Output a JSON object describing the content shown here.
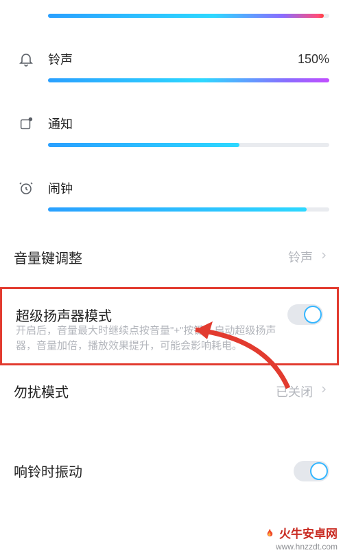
{
  "sliders": {
    "media": {
      "label": "",
      "value_text": "",
      "percent": 98
    },
    "ringtone": {
      "label": "铃声",
      "value_text": "150%",
      "percent": 100
    },
    "notification": {
      "label": "通知",
      "value_text": "",
      "percent": 68
    },
    "alarm": {
      "label": "闹钟",
      "value_text": "",
      "percent": 92
    }
  },
  "rows": {
    "volume_key": {
      "title": "音量键调整",
      "value": "铃声"
    },
    "super_speaker": {
      "title": "超级扬声器模式",
      "desc": "开启后，音量最大时继续点按音量\"+\"按键，启动超级扬声器，音量加倍，播放效果提升，可能会影响耗电。",
      "on": false
    },
    "dnd": {
      "title": "勿扰模式",
      "value": "已关闭"
    },
    "ring_vibrate": {
      "title": "响铃时振动",
      "on": true
    }
  },
  "watermark": {
    "brand": "火牛安卓网",
    "url": "www.hnzzdt.com"
  }
}
